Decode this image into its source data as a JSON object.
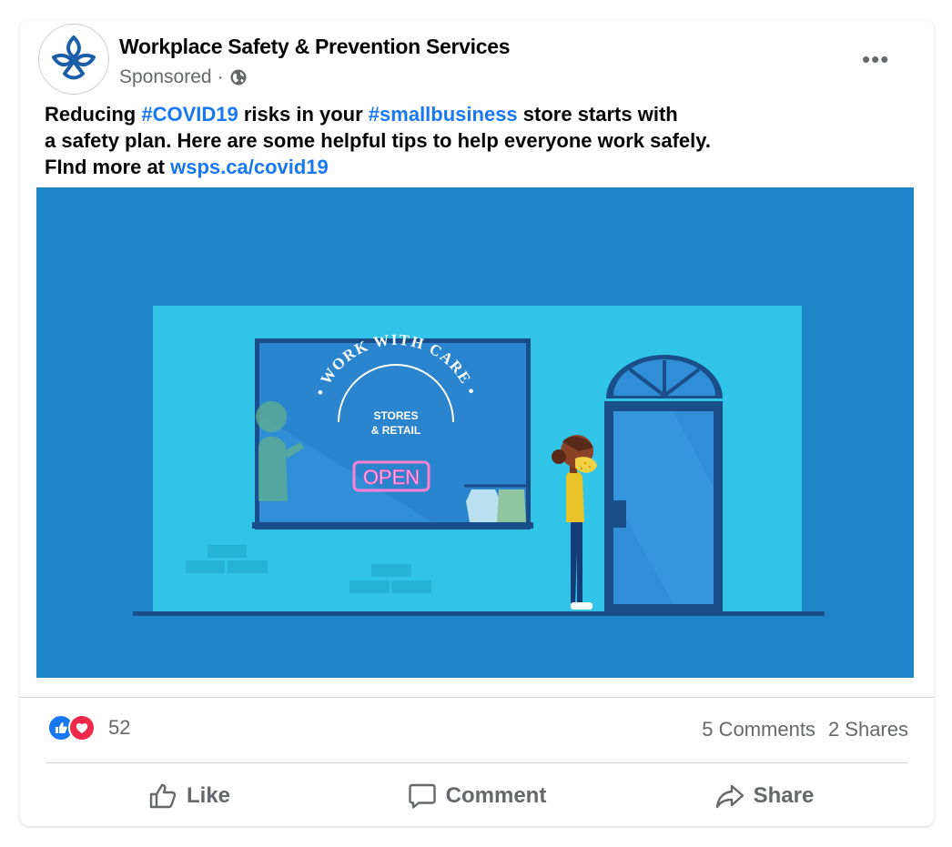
{
  "post": {
    "page_name": "Workplace Safety & Prevention Services",
    "sponsored_label": "Sponsored",
    "separator": "·",
    "more_label": "•••",
    "caption": {
      "line1_a": "Reducing ",
      "line1_hashtag1": "#COVID19",
      "line1_b": " risks in your ",
      "line1_hashtag2": "#smallbusiness",
      "line1_c": " store starts with",
      "line2": "a safety plan. Here are some helpful tips to help everyone work safely.",
      "line3_a": "FInd more at ",
      "line3_link": "wsps.ca/covid19"
    },
    "media": {
      "arc_text": "• WORK WITH CARE •",
      "sign_line1": "STORES",
      "sign_line2": "& RETAIL",
      "neon_sign": "OPEN"
    },
    "engagement": {
      "reaction_count": "52",
      "comments": "5 Comments",
      "shares": "2 Shares"
    },
    "actions": {
      "like": "Like",
      "comment": "Comment",
      "share": "Share"
    }
  },
  "colors": {
    "brand_blue": "#1877f2",
    "media_bg": "#1e86c8",
    "storefront": "#2fc4e8",
    "love_red": "#f02849"
  },
  "icons": [
    "wsps-trillium-logo",
    "globe-icon",
    "more-options-icon",
    "like-reaction-icon",
    "love-reaction-icon",
    "thumbs-up-icon",
    "comment-icon",
    "share-icon"
  ]
}
